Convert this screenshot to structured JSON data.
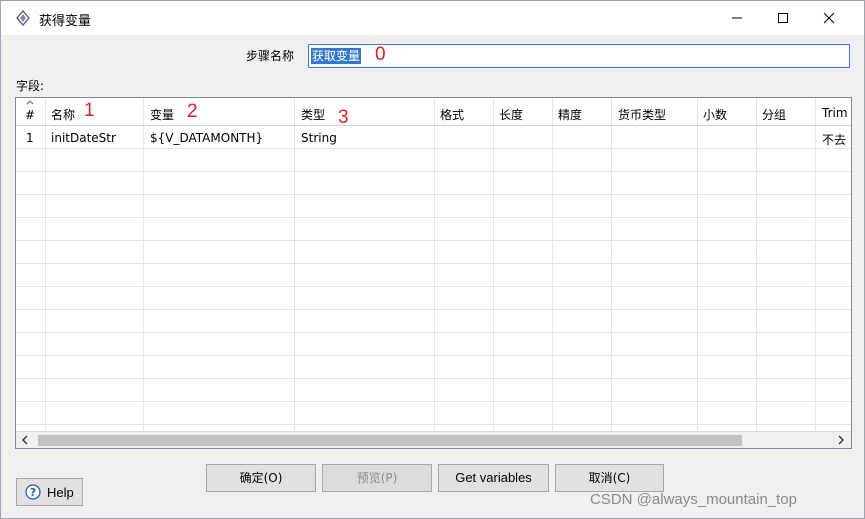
{
  "window": {
    "title": "获得变量",
    "icon": "kettle-step-icon",
    "controls": [
      "minimize-icon",
      "maximize-icon",
      "close-icon"
    ]
  },
  "step": {
    "label": "步骤名称",
    "value": "获取变量"
  },
  "annotations": [
    "0",
    "1",
    "2",
    "3"
  ],
  "fields": {
    "label": "字段:",
    "columns": [
      "#",
      "名称",
      "变量",
      "类型",
      "格式",
      "长度",
      "精度",
      "货币类型",
      "小数",
      "分组",
      "Trim"
    ],
    "rows": [
      [
        "1",
        "initDateStr",
        "${V_DATAMONTH}",
        "String",
        "",
        "",
        "",
        "",
        "",
        "",
        "不去"
      ]
    ]
  },
  "buttons": {
    "ok": "确定(O)",
    "preview": "预览(P)",
    "get_variables": "Get variables",
    "cancel": "取消(C)",
    "help": "Help"
  },
  "watermark": "CSDN @always_mountain_top",
  "colors": {
    "selection": "#3478c8",
    "annotation": "#e02020",
    "focus_border": "#3c7fc8"
  }
}
